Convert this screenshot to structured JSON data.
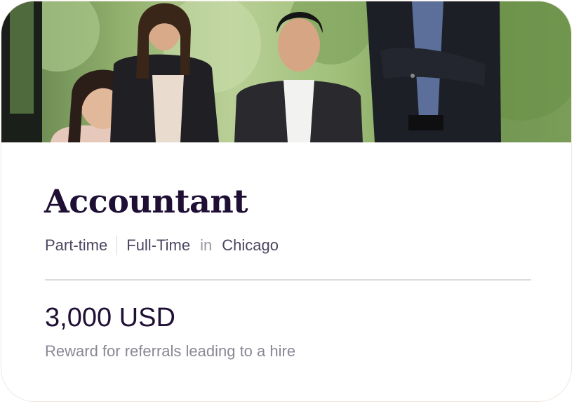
{
  "job": {
    "title": "Accountant",
    "employment_types": [
      "Part-time",
      "Full-Time"
    ],
    "location_connector": "in",
    "location": "Chicago"
  },
  "reward": {
    "amount": "3,000 USD",
    "caption": "Reward for referrals leading to a hire"
  },
  "colors": {
    "title": "#1f0f35",
    "meta_text": "#4d4560",
    "muted_text": "#8b8794",
    "card_border": "#f2e8df",
    "divider": "#dcdbdf"
  }
}
